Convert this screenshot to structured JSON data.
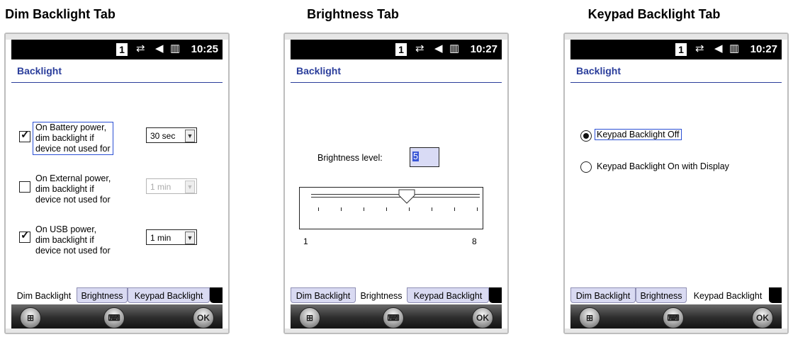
{
  "captions": [
    "Dim Backlight Tab",
    "Brightness Tab",
    "Keypad Backlight Tab"
  ],
  "status": {
    "sim": "1",
    "time1": "10:25",
    "time2": "10:27",
    "time3": "10:27"
  },
  "title": "Backlight",
  "dim": {
    "battery_label": "On Battery power,\ndim backlight if\ndevice not used for",
    "battery_value": "30 sec",
    "external_label": "On External power,\ndim backlight if\ndevice not used for",
    "external_value": "1 min",
    "usb_label": "On USB power,\ndim backlight if\ndevice not used for",
    "usb_value": "1 min"
  },
  "brightness": {
    "label": "Brightness level:",
    "value": "5",
    "min": "1",
    "max": "8"
  },
  "keypad": {
    "off_label": "Keypad Backlight Off",
    "on_label": "Keypad Backlight On with Display"
  },
  "tabs": [
    "Dim Backlight",
    "Brightness",
    "Keypad Backlight"
  ],
  "softkeys": {
    "ok": "OK"
  }
}
